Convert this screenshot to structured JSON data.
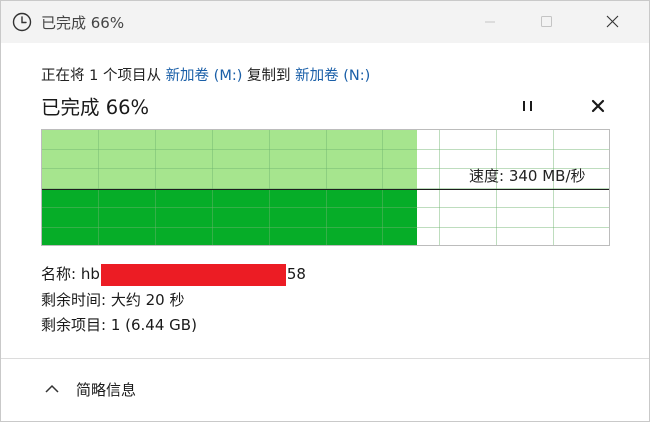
{
  "window": {
    "title": "已完成 66%"
  },
  "copy": {
    "prefix": "正在将 1 个项目从 ",
    "source": "新加卷 (M:)",
    "middle": " 复制到 ",
    "destination": "新加卷 (N:)"
  },
  "progress": {
    "title": "已完成 66%",
    "percent": 66,
    "speed_label": "速度: 340 MB/秒"
  },
  "file_info": {
    "name_label": "名称:",
    "name_prefix": "hb",
    "name_suffix": "58",
    "time_remaining": "剩余时间: 大约 20 秒",
    "items_remaining": "剩余项目: 1 (6.44 GB)"
  },
  "footer": {
    "details_label": "简略信息"
  },
  "icons": {
    "title_icon": "clock-icon",
    "minimize": "minimize-icon",
    "maximize": "maximize-icon",
    "close": "close-icon",
    "pause": "pause-icon",
    "cancel": "cancel-icon",
    "collapse": "chevron-up-icon"
  },
  "colors": {
    "progress_fill": "#a6e58e",
    "speed_fill": "#06ad28",
    "link": "#1a5fa8",
    "redaction": "#ec1c24"
  }
}
